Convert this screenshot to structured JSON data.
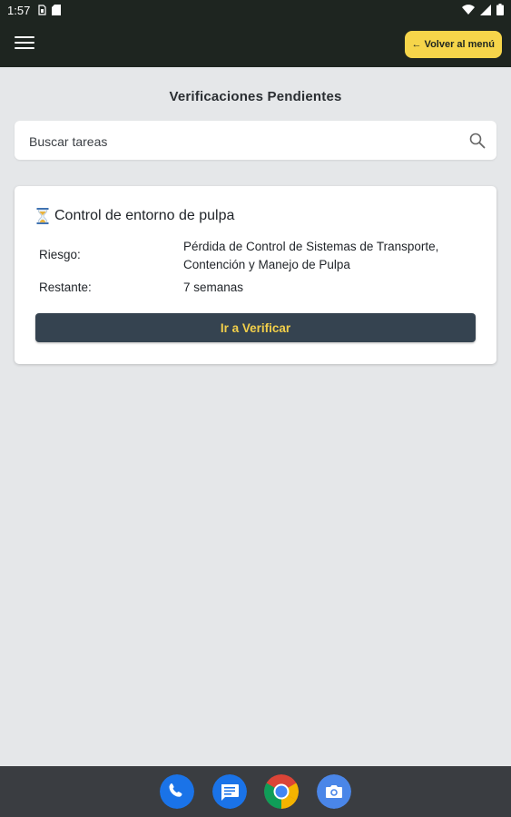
{
  "status_bar": {
    "time": "1:57"
  },
  "app_bar": {
    "menu_icon": "hamburger-icon",
    "back_button_label": "← Volver al menú"
  },
  "page": {
    "title": "Verificaciones Pendientes"
  },
  "search": {
    "placeholder": "Buscar tareas",
    "icon": "search-icon"
  },
  "tasks": [
    {
      "icon": "hourglass-icon",
      "title": "Control de entorno de pulpa",
      "risk_label": "Riesgo:",
      "risk_value": "Pérdida de Control de Sistemas de Transporte, Contención y Manejo de Pulpa",
      "remaining_label": "Restante:",
      "remaining_value": "7 semanas",
      "action_label": "Ir a Verificar"
    }
  ],
  "dock": [
    "phone-icon",
    "messages-icon",
    "chrome-icon",
    "camera-icon"
  ],
  "colors": {
    "app_bar": "#1e2520",
    "accent_yellow": "#f6d54a",
    "button_dark": "#354350",
    "background": "#e5e7e9"
  }
}
